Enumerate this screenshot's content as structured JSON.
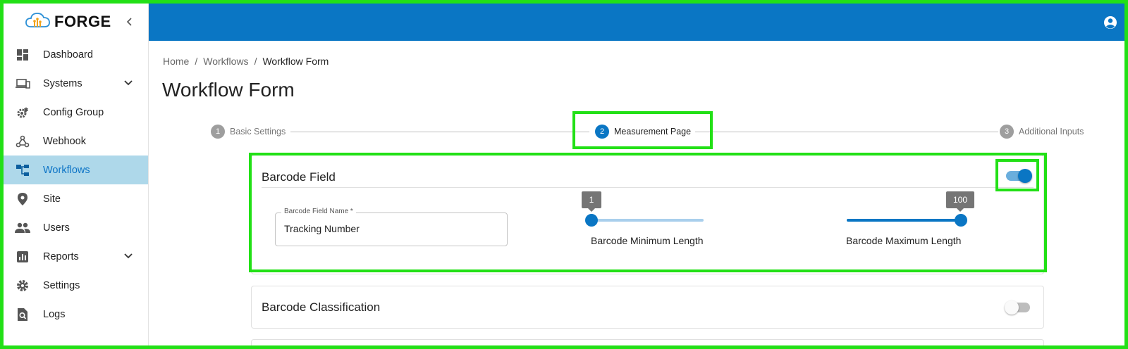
{
  "app": {
    "logo_text": "FORGE"
  },
  "sidebar": {
    "items": [
      {
        "label": "Dashboard",
        "icon": "dashboard-icon"
      },
      {
        "label": "Systems",
        "icon": "devices-icon",
        "expandable": true
      },
      {
        "label": "Config Group",
        "icon": "config-gear-icon"
      },
      {
        "label": "Webhook",
        "icon": "webhook-icon"
      },
      {
        "label": "Workflows",
        "icon": "workflow-icon",
        "active": true
      },
      {
        "label": "Site",
        "icon": "location-pin-icon"
      },
      {
        "label": "Users",
        "icon": "users-icon"
      },
      {
        "label": "Reports",
        "icon": "reports-icon",
        "expandable": true
      },
      {
        "label": "Settings",
        "icon": "settings-gear-icon"
      },
      {
        "label": "Logs",
        "icon": "logs-search-icon"
      }
    ]
  },
  "breadcrumb": {
    "home": "Home",
    "workflows": "Workflows",
    "current": "Workflow Form",
    "separator": "/"
  },
  "page": {
    "title": "Workflow Form"
  },
  "stepper": {
    "steps": [
      {
        "number": "1",
        "label": "Basic Settings"
      },
      {
        "number": "2",
        "label": "Measurement Page",
        "active": true
      },
      {
        "number": "3",
        "label": "Additional Inputs"
      }
    ]
  },
  "barcode_field": {
    "title": "Barcode Field",
    "enabled": true,
    "name_label": "Barcode Field Name *",
    "name_value": "Tracking Number",
    "min_length": {
      "value": "1",
      "caption": "Barcode Minimum Length",
      "fraction": 0.0
    },
    "max_length": {
      "value": "100",
      "caption": "Barcode Maximum Length",
      "fraction": 1.0
    }
  },
  "barcode_classification": {
    "title": "Barcode Classification",
    "enabled": false
  },
  "colors": {
    "primary": "#0a76c4",
    "active_nav_bg": "#aed8ea",
    "highlight": "#22e016"
  }
}
